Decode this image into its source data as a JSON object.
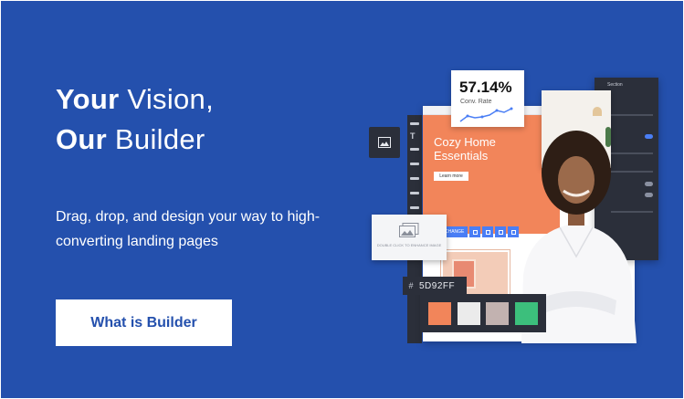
{
  "banner": {
    "background": "#2450ad",
    "headline": {
      "line1_bold": "Your",
      "line1_rest": " Vision,",
      "line2_bold": "Our",
      "line2_rest": " Builder"
    },
    "subtext": "Drag, drop, and design your way to high-converting landing pages",
    "cta_label": "What is Builder"
  },
  "collage": {
    "stat": {
      "value": "57.14%",
      "label": "Conv. Rate"
    },
    "hero": {
      "title": "Cozy Home Essentials",
      "button": "Learn more",
      "color": "#f2855a"
    },
    "edit_bar": {
      "change_label": "CHANGE"
    },
    "drop_hint": "DOUBLE CLICK TO ENHANCE IMAGE",
    "color_picker": {
      "hash": "#",
      "hex": "5D92FF",
      "swatches": [
        "#f2855a",
        "#ebebeb",
        "#c2b2b0",
        "#3cbf7c"
      ]
    },
    "settings_title": "Section"
  }
}
